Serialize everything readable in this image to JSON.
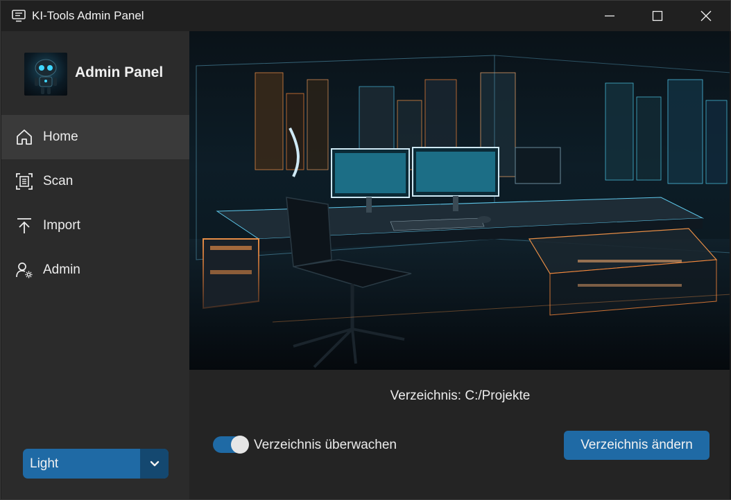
{
  "window": {
    "title": "KI-Tools Admin Panel",
    "icons": {
      "app": "monitor-icon",
      "minimize": "minimize-icon",
      "maximize": "maximize-icon",
      "close": "close-icon"
    }
  },
  "sidebar": {
    "logo_icon": "robot-logo",
    "title": "Admin Panel",
    "items": [
      {
        "label": "Home",
        "icon": "home-icon",
        "active": true
      },
      {
        "label": "Scan",
        "icon": "scan-icon",
        "active": false
      },
      {
        "label": "Import",
        "icon": "import-icon",
        "active": false
      },
      {
        "label": "Admin",
        "icon": "admin-icon",
        "active": false
      }
    ],
    "theme_select": {
      "value": "Light",
      "icon": "chevron-down-icon"
    }
  },
  "main": {
    "hero_image": "futuristic-office-image",
    "directory_label": "Verzeichnis: C:/Projekte",
    "watch_toggle": {
      "label": "Verzeichnis überwachen",
      "on": true
    },
    "change_button": "Verzeichnis ändern"
  },
  "colors": {
    "accent": "#1f6aa5",
    "accent_dark": "#144870",
    "sidebar_bg": "#2b2b2b",
    "main_bg": "#242424",
    "active_item_bg": "#3a3a3a"
  }
}
